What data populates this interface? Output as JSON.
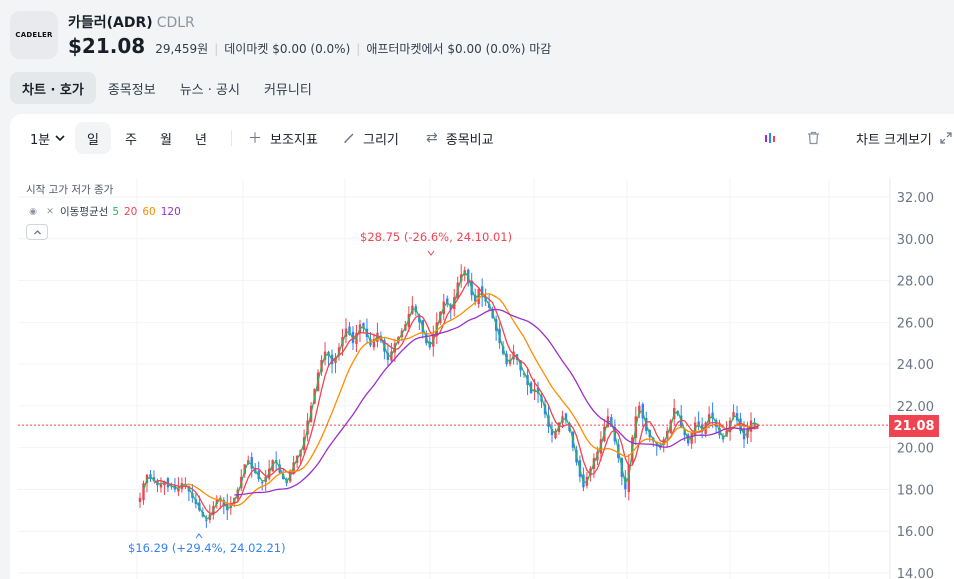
{
  "header": {
    "logo_text": "CADELER",
    "name": "카들러(ADR)",
    "ticker": "CDLR",
    "price": "$21.08",
    "price_krw": "29,459원",
    "premarket": "데이마켓 $0.00 (0.0%)",
    "aftermarket": "애프터마켓에서 $0.00 (0.0%) 마감"
  },
  "tabs": [
    "차트 · 호가",
    "종목정보",
    "뉴스 · 공시",
    "커뮤니티"
  ],
  "toolbar": {
    "interval": "1분",
    "periods": [
      "일",
      "주",
      "월",
      "년"
    ],
    "indicator_label": "보조지표",
    "draw_label": "그리기",
    "compare_label": "종목비교",
    "resize_label": "차트 크게보기"
  },
  "legend": {
    "ohlc": "시작 고가 저가 종가",
    "ma_title": "이동평균선",
    "ma_periods": [
      {
        "label": "5",
        "color": "#2fb35a"
      },
      {
        "label": "20",
        "color": "#f04452"
      },
      {
        "label": "60",
        "color": "#ff8c00"
      },
      {
        "label": "120",
        "color": "#9b30c8"
      }
    ]
  },
  "chart_data": {
    "type": "candlestick",
    "ylim": [
      14,
      32.5
    ],
    "yticks": [
      "32.00",
      "30.00",
      "28.00",
      "26.00",
      "24.00",
      "22.00",
      "20.00",
      "18.00",
      "16.00",
      "14.00"
    ],
    "current_price": "21.08",
    "annotation_high": "$28.75 (-26.6%, 24.10.01)",
    "annotation_low": "$16.29 (+29.4%, 24.02.21)",
    "up_color": "#f04452",
    "down_color": "#3182f6",
    "close_series": [
      17.6,
      18.3,
      18.7,
      18.5,
      18.4,
      18.2,
      18.3,
      18.4,
      18.1,
      18.2,
      18.0,
      18.1,
      18.3,
      18.2,
      17.9,
      17.6,
      17.3,
      17.0,
      16.7,
      16.5,
      16.8,
      17.2,
      17.5,
      17.6,
      17.2,
      17.0,
      17.3,
      17.6,
      18.0,
      18.6,
      19.2,
      19.4,
      19.0,
      18.8,
      18.5,
      18.3,
      18.6,
      19.0,
      19.4,
      19.3,
      18.8,
      18.5,
      18.3,
      18.9,
      19.3,
      19.6,
      19.9,
      20.5,
      21.3,
      22.0,
      22.8,
      23.6,
      24.2,
      24.6,
      24.4,
      24.0,
      24.3,
      24.8,
      25.3,
      25.7,
      25.4,
      25.0,
      25.5,
      25.9,
      25.7,
      25.3,
      24.9,
      25.2,
      25.5,
      25.1,
      24.6,
      24.2,
      24.6,
      25.0,
      25.3,
      25.6,
      25.9,
      26.4,
      26.8,
      26.5,
      26.0,
      25.5,
      25.0,
      24.8,
      25.4,
      26.0,
      26.5,
      27.0,
      26.9,
      26.6,
      27.2,
      27.9,
      28.3,
      28.5,
      27.9,
      27.3,
      27.0,
      27.6,
      27.2,
      27.0,
      26.7,
      26.2,
      25.6,
      25.0,
      24.5,
      24.0,
      24.2,
      24.6,
      24.2,
      23.7,
      23.5,
      23.0,
      22.6,
      22.8,
      22.6,
      22.2,
      21.6,
      21.0,
      20.6,
      20.8,
      21.2,
      21.5,
      21.3,
      20.8,
      20.0,
      19.3,
      18.6,
      18.1,
      18.6,
      19.0,
      19.5,
      19.8,
      20.4,
      21.0,
      21.5,
      21.0,
      20.3,
      19.5,
      18.6,
      18.0,
      19.2,
      20.5,
      21.5,
      22.0,
      21.4,
      20.8,
      20.5,
      20.3,
      20.1,
      20.0,
      20.4,
      20.8,
      21.3,
      21.9,
      21.6,
      21.0,
      20.6,
      20.2,
      20.7,
      21.2,
      21.0,
      20.8,
      21.2,
      21.6,
      21.4,
      21.0,
      20.6,
      20.4,
      20.8,
      21.3,
      21.7,
      21.3,
      20.8,
      20.4,
      20.9,
      21.3,
      21.1,
      21.08
    ],
    "ma_series": {
      "5": "#2fb35a",
      "20": "#f04452",
      "60": "#ff8c00",
      "120": "#9b30c8"
    }
  }
}
